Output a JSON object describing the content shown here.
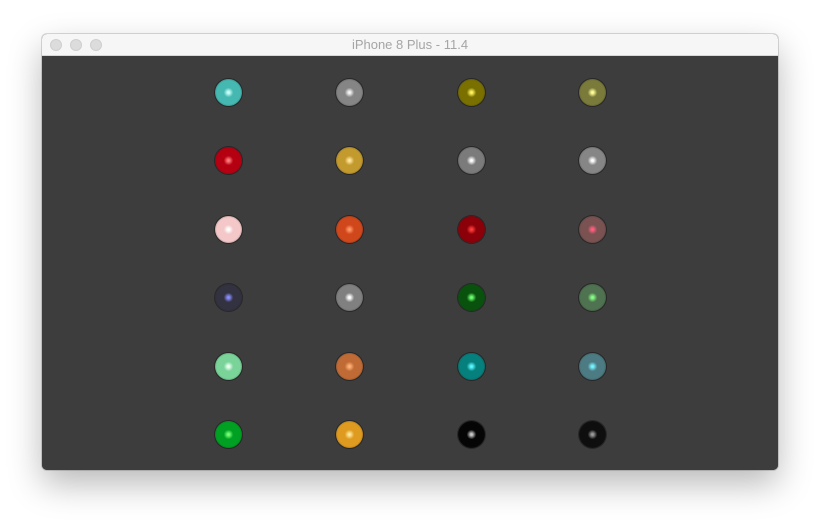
{
  "window": {
    "title": "iPhone 8 Plus - 11.4",
    "buttons": [
      {
        "name": "window-close-button",
        "class": "close"
      },
      {
        "name": "window-minimize-button",
        "class": "minimize"
      },
      {
        "name": "window-zoom-button",
        "class": "zoom"
      }
    ]
  },
  "spheres": [
    [
      {
        "color": "#46b8b2",
        "highlight": "#c8fff8"
      },
      {
        "color": "#858585",
        "highlight": "#f5f5f5"
      },
      {
        "color": "#7a7000",
        "highlight": "#fff45a"
      },
      {
        "color": "#7a7a3b",
        "highlight": "#ffff95"
      }
    ],
    [
      {
        "color": "#b50012",
        "highlight": "#ff7a7a"
      },
      {
        "color": "#c39a2d",
        "highlight": "#ffe49a"
      },
      {
        "color": "#7b7b7b",
        "highlight": "#ffffff"
      },
      {
        "color": "#868686",
        "highlight": "#ffffff"
      }
    ],
    [
      {
        "color": "#f4c8c8",
        "highlight": "#ffffff"
      },
      {
        "color": "#d0471c",
        "highlight": "#ff9464"
      },
      {
        "color": "#8c0009",
        "highlight": "#ff3b3b"
      },
      {
        "color": "#7a5252",
        "highlight": "#ff5f7e"
      }
    ],
    [
      {
        "color": "#333241",
        "highlight": "#8a8cff"
      },
      {
        "color": "#808080",
        "highlight": "#ffffff"
      },
      {
        "color": "#09520e",
        "highlight": "#6bff6b"
      },
      {
        "color": "#4f7350",
        "highlight": "#84ff84"
      }
    ],
    [
      {
        "color": "#7ad49a",
        "highlight": "#e8ffee"
      },
      {
        "color": "#c06b35",
        "highlight": "#ffb074"
      },
      {
        "color": "#05807d",
        "highlight": "#5af7ff"
      },
      {
        "color": "#4c7b83",
        "highlight": "#75f4ff"
      }
    ],
    [
      {
        "color": "#00a123",
        "highlight": "#74ff74"
      },
      {
        "color": "#de9b1f",
        "highlight": "#ffe69a"
      },
      {
        "color": "#050505",
        "highlight": "#c8c8c8"
      },
      {
        "color": "#0e0e0e",
        "highlight": "#9a9a9a"
      }
    ]
  ]
}
